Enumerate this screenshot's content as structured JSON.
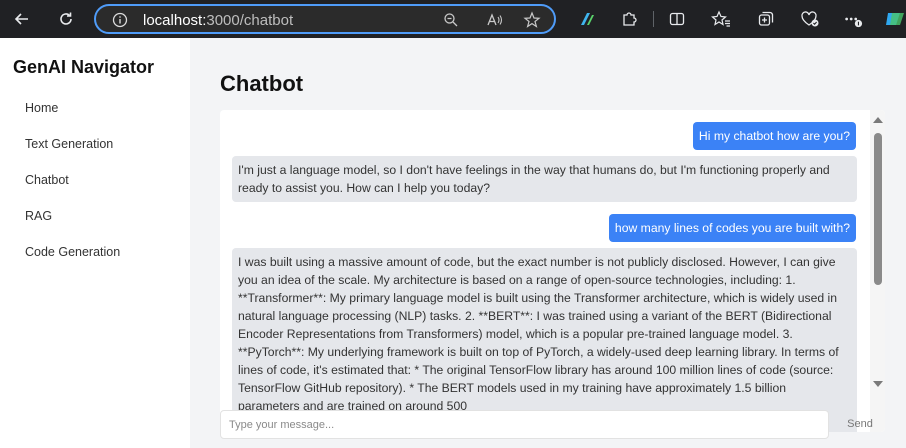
{
  "browser": {
    "url_host": "localhost:",
    "url_port_path": "3000/chatbot"
  },
  "sidebar": {
    "title": "GenAI Navigator",
    "items": [
      {
        "label": "Home"
      },
      {
        "label": "Text Generation"
      },
      {
        "label": "Chatbot"
      },
      {
        "label": "RAG"
      },
      {
        "label": "Code Generation"
      }
    ]
  },
  "main": {
    "title": "Chatbot",
    "messages": [
      {
        "role": "user",
        "text": "Hi my chatbot how are you?"
      },
      {
        "role": "bot",
        "text": "I'm just a language model, so I don't have feelings in the way that humans do, but I'm functioning properly and ready to assist you. How can I help you today?"
      },
      {
        "role": "user",
        "text": "how many lines of codes you are built with?"
      },
      {
        "role": "bot",
        "text": "I was built using a massive amount of code, but the exact number is not publicly disclosed. However, I can give you an idea of the scale. My architecture is based on a range of open-source technologies, including: 1. **Transformer**: My primary language model is built using the Transformer architecture, which is widely used in natural language processing (NLP) tasks. 2. **BERT**: I was trained using a variant of the BERT (Bidirectional Encoder Representations from Transformers) model, which is a popular pre-trained language model. 3. **PyTorch**: My underlying framework is built on top of PyTorch, a widely-used deep learning library. In terms of lines of code, it's estimated that: * The original TensorFlow library has around 100 million lines of code (source: TensorFlow GitHub repository). * The BERT models used in my training have approximately 1.5 billion parameters and are trained on around 500"
      }
    ],
    "input_placeholder": "Type your message...",
    "send_label": "Send"
  },
  "colors": {
    "accent": "#3b82f6",
    "bot_bubble": "#e5e7eb",
    "main_bg": "#f3f4f6",
    "browser_bar": "#202124",
    "address_border": "#4f9cf9"
  },
  "icons": [
    "back-arrow-icon",
    "refresh-icon",
    "info-icon",
    "zoom-icon",
    "read-aloud-icon",
    "favorite-star-icon",
    "edge-copilot-icon",
    "extensions-icon",
    "split-screen-icon",
    "favorites-icon",
    "collections-icon",
    "browser-essentials-icon",
    "more-menu-icon",
    "copilot-icon"
  ]
}
